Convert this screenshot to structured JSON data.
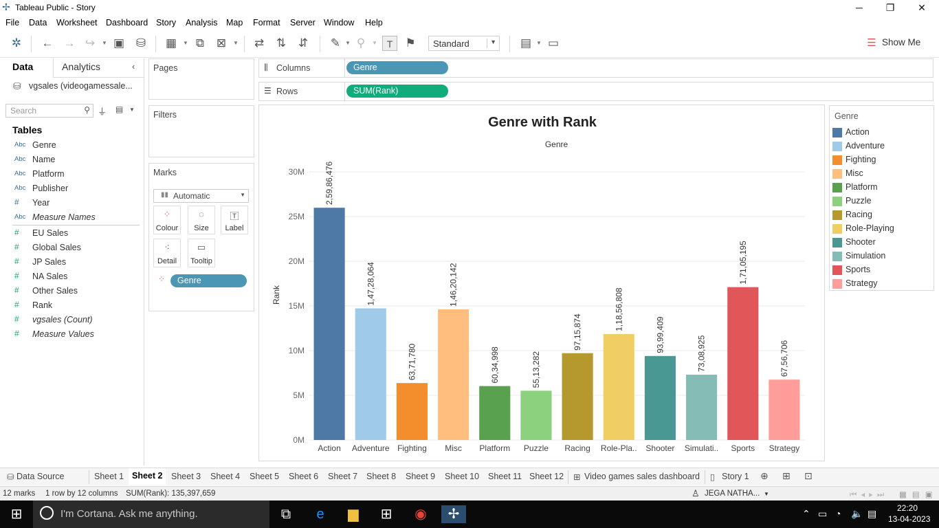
{
  "window": {
    "title": "Tableau Public - Story",
    "controls": {
      "minimize": "─",
      "restore": "❐",
      "close": "✕"
    }
  },
  "menu": [
    "File",
    "Data",
    "Worksheet",
    "Dashboard",
    "Story",
    "Analysis",
    "Map",
    "Format",
    "Server",
    "Window",
    "Help"
  ],
  "toolbar": {
    "fit_select": "Standard",
    "show_me": "Show Me"
  },
  "data_pane": {
    "tabs": [
      "Data",
      "Analytics"
    ],
    "datasource": "vgsales (videogamessale...",
    "search_placeholder": "Search",
    "tables_heading": "Tables",
    "dimensions": [
      {
        "type": "Abc",
        "name": "Genre"
      },
      {
        "type": "Abc",
        "name": "Name"
      },
      {
        "type": "Abc",
        "name": "Platform"
      },
      {
        "type": "Abc",
        "name": "Publisher"
      },
      {
        "type": "#",
        "name": "Year"
      },
      {
        "type": "Abc",
        "name": "Measure Names"
      }
    ],
    "measures": [
      {
        "type": "#",
        "name": "EU Sales"
      },
      {
        "type": "#",
        "name": "Global Sales"
      },
      {
        "type": "#",
        "name": "JP Sales"
      },
      {
        "type": "#",
        "name": "NA Sales"
      },
      {
        "type": "#",
        "name": "Other Sales"
      },
      {
        "type": "#",
        "name": "Rank"
      },
      {
        "type": "#",
        "name": "vgsales (Count)"
      },
      {
        "type": "#",
        "name": "Measure Values"
      }
    ]
  },
  "cards": {
    "pages": "Pages",
    "filters": "Filters",
    "marks": "Marks",
    "marks_type": "Automatic",
    "mark_buttons": [
      "Colour",
      "Size",
      "Label",
      "Detail",
      "Tooltip"
    ],
    "marks_pill": "Genre"
  },
  "shelves": {
    "columns_label": "Columns",
    "columns_pill": "Genre",
    "rows_label": "Rows",
    "rows_pill": "SUM(Rank)"
  },
  "chart_data": {
    "type": "bar",
    "title": "Genre with Rank",
    "subtitle": "Genre",
    "xlabel": "",
    "ylabel": "Rank",
    "ylim": [
      0,
      30000000
    ],
    "yticks": [
      0,
      5000000,
      10000000,
      15000000,
      20000000,
      25000000,
      30000000
    ],
    "ytick_labels": [
      "0M",
      "5M",
      "10M",
      "15M",
      "20M",
      "25M",
      "30M"
    ],
    "categories": [
      "Action",
      "Adventure",
      "Fighting",
      "Misc",
      "Platform",
      "Puzzle",
      "Racing",
      "Role-Pla..",
      "Shooter",
      "Simulati..",
      "Sports",
      "Strategy"
    ],
    "values": [
      25986476,
      14728064,
      6371780,
      14620142,
      6034998,
      5513282,
      9715874,
      11856808,
      9399409,
      7308925,
      17105195,
      6756706
    ],
    "data_labels": [
      "2,59,86,476",
      "1,47,28,064",
      "63,71,780",
      "1,46,20,142",
      "60,34,998",
      "55,13,282",
      "97,15,874",
      "1,18,56,808",
      "93,99,409",
      "73,08,925",
      "1,71,05,195",
      "67,56,706"
    ],
    "colors": [
      "#4e79a7",
      "#a0cbe8",
      "#f28e2b",
      "#ffbe7d",
      "#59a14f",
      "#8cd17d",
      "#b6992d",
      "#f1ce63",
      "#499894",
      "#86bcb6",
      "#e15759",
      "#ff9d9a"
    ],
    "grid": true
  },
  "legend": {
    "title": "Genre",
    "items": [
      "Action",
      "Adventure",
      "Fighting",
      "Misc",
      "Platform",
      "Puzzle",
      "Racing",
      "Role-Playing",
      "Shooter",
      "Simulation",
      "Sports",
      "Strategy"
    ]
  },
  "sheet_tabs": [
    "Data Source",
    "Sheet 1",
    "Sheet 2",
    "Sheet 3",
    "Sheet 4",
    "Sheet 5",
    "Sheet 6",
    "Sheet 7",
    "Sheet 8",
    "Sheet 9",
    "Sheet 10",
    "Sheet 11",
    "Sheet 12",
    "Video games sales dashboard",
    "Story 1"
  ],
  "active_sheet": "Sheet 2",
  "status": {
    "marks": "12 marks",
    "dims": "1 row by 12 columns",
    "sum": "SUM(Rank): 135,397,659",
    "user": "JEGA NATHA..."
  },
  "taskbar": {
    "cortana": "I'm Cortana. Ask me anything.",
    "time": "22:20",
    "date": "13-04-2023"
  }
}
